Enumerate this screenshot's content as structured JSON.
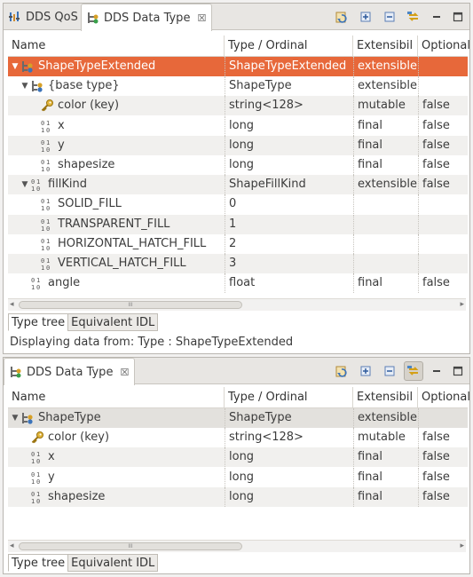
{
  "top_panel": {
    "tabs": [
      {
        "label": "DDS QoS",
        "icon": "qos-bars-icon",
        "active": false
      },
      {
        "label": "DDS Data Type",
        "icon": "data-type-tree-icon",
        "active": true,
        "close": "☒"
      }
    ],
    "columns": [
      "Name",
      "Type / Ordinal",
      "Extensibil",
      "Optional"
    ],
    "rows": [
      {
        "name": "ShapeTypeExtended",
        "type": "ShapeTypeExtended",
        "ext": "extensible",
        "opt": "",
        "icon": "struct-icon",
        "expanded": true,
        "indent": 0
      },
      {
        "name": "{base type}",
        "type": "ShapeType",
        "ext": "extensible",
        "opt": "",
        "icon": "struct-icon",
        "expanded": true,
        "indent": 1
      },
      {
        "name": "color (key)",
        "type": "string<128>",
        "ext": "mutable",
        "opt": "false",
        "icon": "key-icon",
        "indent": 2
      },
      {
        "name": "x",
        "type": "long",
        "ext": "final",
        "opt": "false",
        "icon": "binary-field-icon",
        "indent": 2
      },
      {
        "name": "y",
        "type": "long",
        "ext": "final",
        "opt": "false",
        "icon": "binary-field-icon",
        "indent": 2
      },
      {
        "name": "shapesize",
        "type": "long",
        "ext": "final",
        "opt": "false",
        "icon": "binary-field-icon",
        "indent": 2
      },
      {
        "name": "fillKind",
        "type": "ShapeFillKind",
        "ext": "extensible",
        "opt": "false",
        "icon": "binary-field-icon",
        "expanded": true,
        "indent": 1
      },
      {
        "name": "SOLID_FILL",
        "type": "0",
        "ext": "",
        "opt": "",
        "icon": "binary-field-icon",
        "indent": 2
      },
      {
        "name": "TRANSPARENT_FILL",
        "type": "1",
        "ext": "",
        "opt": "",
        "icon": "binary-field-icon",
        "indent": 2
      },
      {
        "name": "HORIZONTAL_HATCH_FILL",
        "type": "2",
        "ext": "",
        "opt": "",
        "icon": "binary-field-icon",
        "indent": 2
      },
      {
        "name": "VERTICAL_HATCH_FILL",
        "type": "3",
        "ext": "",
        "opt": "",
        "icon": "binary-field-icon",
        "indent": 2
      },
      {
        "name": "angle",
        "type": "float",
        "ext": "final",
        "opt": "false",
        "icon": "binary-field-icon",
        "indent": 1
      }
    ],
    "scroll_grip": "III",
    "bottom_tabs": [
      "Type tree",
      "Equivalent IDL"
    ],
    "status": "Displaying data from: Type : ShapeTypeExtended"
  },
  "bottom_panel": {
    "tab": {
      "label": "DDS Data Type",
      "icon": "data-type-tree-icon",
      "close": "☒"
    },
    "columns": [
      "Name",
      "Type / Ordinal",
      "Extensibil",
      "Optional"
    ],
    "rows": [
      {
        "name": "ShapeType",
        "type": "ShapeType",
        "ext": "extensible",
        "opt": "",
        "icon": "struct-icon",
        "expanded": true,
        "indent": 0
      },
      {
        "name": "color (key)",
        "type": "string<128>",
        "ext": "mutable",
        "opt": "false",
        "icon": "key-icon",
        "indent": 1
      },
      {
        "name": "x",
        "type": "long",
        "ext": "final",
        "opt": "false",
        "icon": "binary-field-icon",
        "indent": 1
      },
      {
        "name": "y",
        "type": "long",
        "ext": "final",
        "opt": "false",
        "icon": "binary-field-icon",
        "indent": 1
      },
      {
        "name": "shapesize",
        "type": "long",
        "ext": "final",
        "opt": "false",
        "icon": "binary-field-icon",
        "indent": 1
      }
    ],
    "scroll_grip": "III",
    "bottom_tabs": [
      "Type tree",
      "Equivalent IDL"
    ]
  },
  "colors": {
    "selection": "#e7683a",
    "link_toggle_pressed": "#d6d2cb"
  }
}
